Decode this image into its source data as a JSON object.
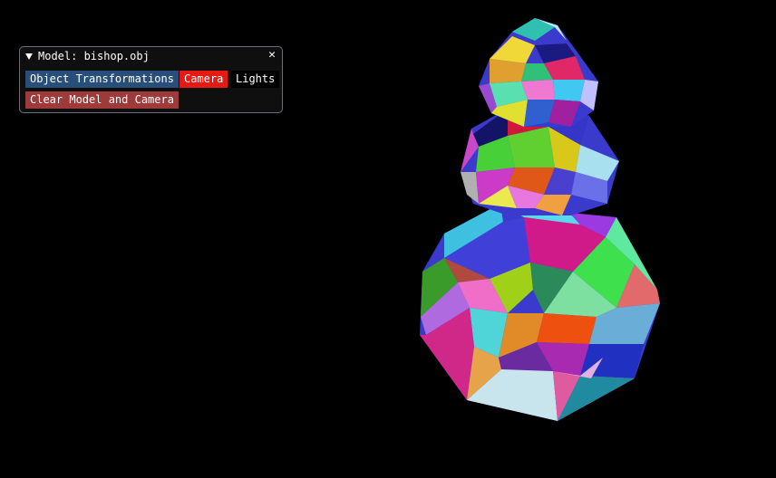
{
  "window": {
    "title": "Model: bishop.obj",
    "close_glyph": "✕",
    "collapse_icon": "triangle-down-icon"
  },
  "buttons": {
    "object_transformations": "Object Transformations",
    "camera": "Camera",
    "lights": "Lights",
    "clear_model_camera": "Clear Model and Camera"
  },
  "colors": {
    "background": "#000000",
    "panel_background": "#0f0f10",
    "panel_border": "#6e6e78",
    "transform_button": "#284f79",
    "camera_button": "#e51a13",
    "lights_button": "#000000",
    "clear_button": "#9e3a3a"
  },
  "scene": {
    "model": "bishop.obj",
    "render_style": "random-colored-triangle-faces"
  }
}
